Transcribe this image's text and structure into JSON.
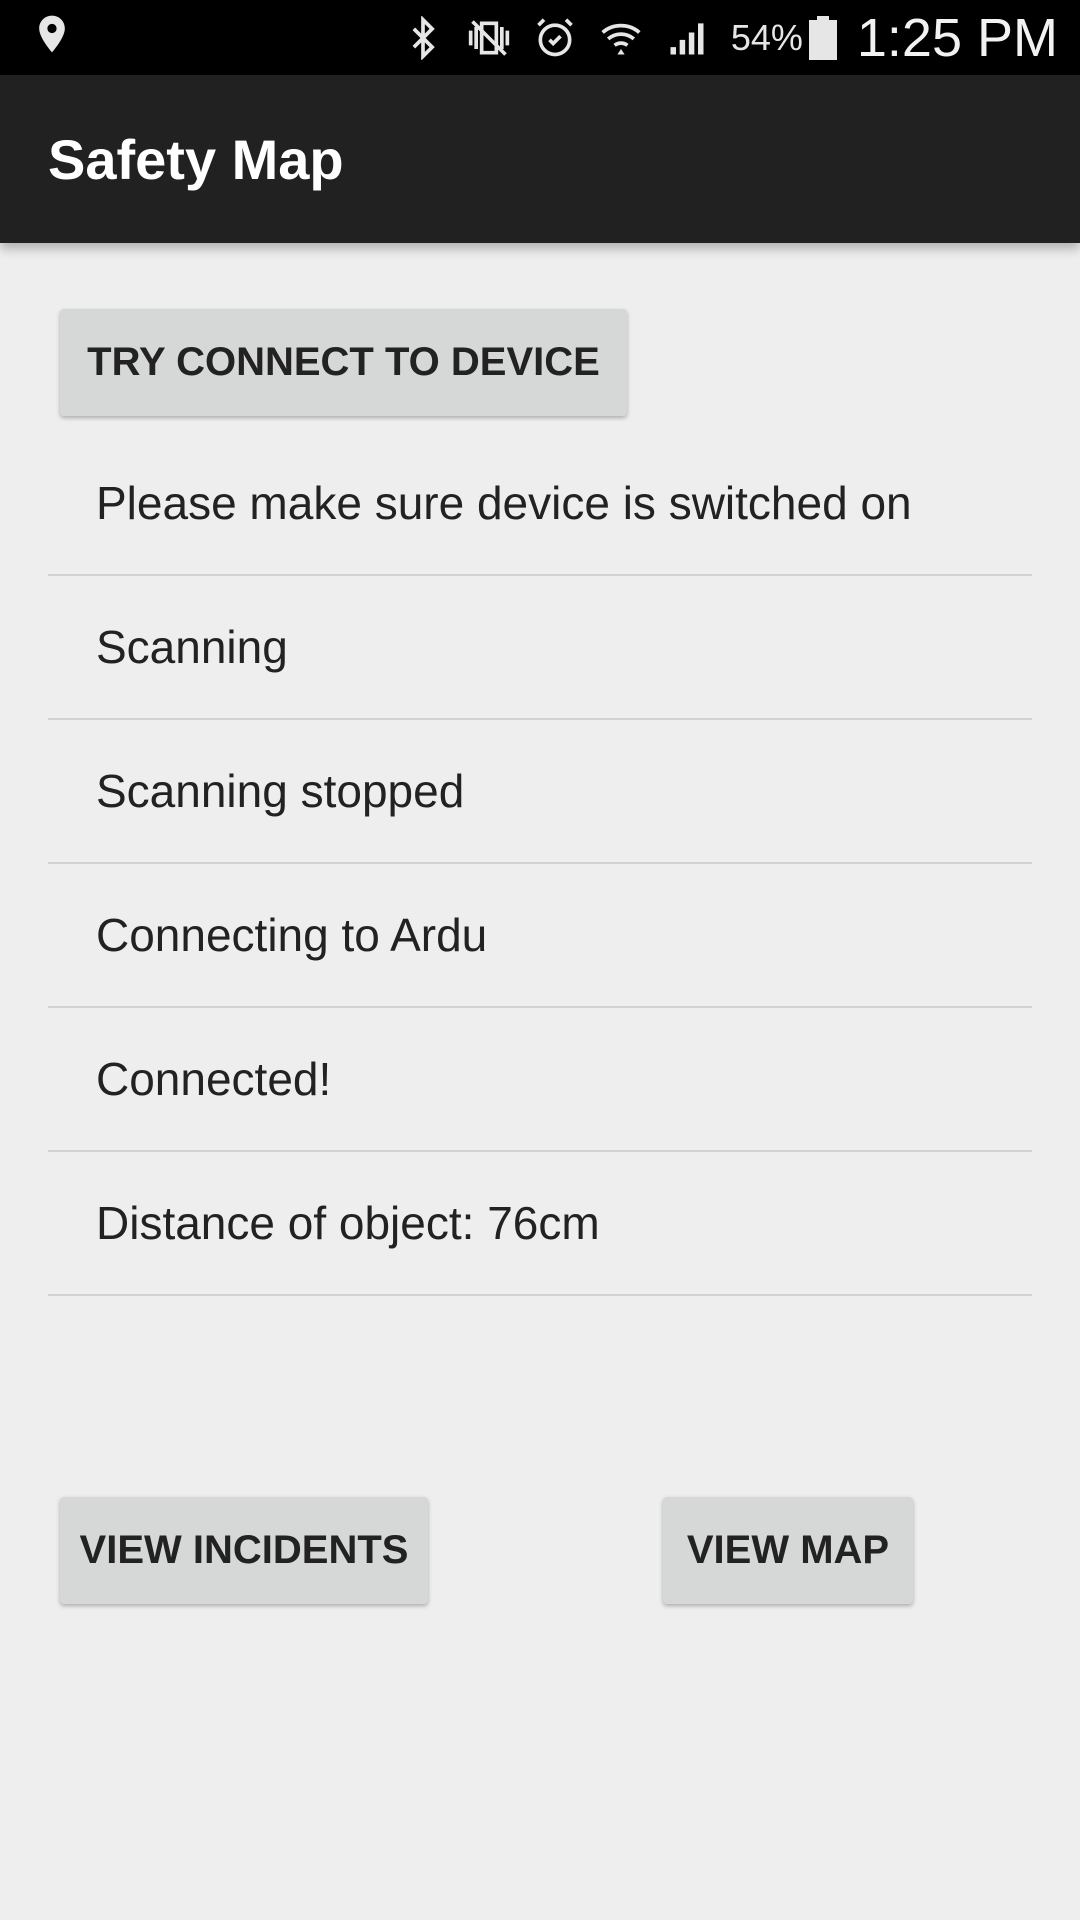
{
  "status_bar": {
    "icons_left": [
      "location-pin-icon"
    ],
    "icons_right": [
      "bluetooth-icon",
      "vibrate-mute-icon",
      "alarm-icon",
      "wifi-icon",
      "signal-icon",
      "battery-icon"
    ],
    "battery_percent": "54%",
    "time": "1:25 PM"
  },
  "app_bar": {
    "title": "Safety Map"
  },
  "main": {
    "connect_button_label": "TRY CONNECT TO DEVICE",
    "log_items": [
      "Please make sure device is switched on",
      "Scanning",
      "Scanning stopped",
      "Connecting to Ardu",
      "Connected!",
      "Distance of object: 76cm"
    ],
    "view_incidents_label": "VIEW INCIDENTS",
    "view_map_label": "VIEW MAP"
  },
  "colors": {
    "status_bar_bg": "#000000",
    "app_bar_bg": "#212121",
    "page_bg": "#eeeeee",
    "button_bg": "#d6d7d7"
  }
}
